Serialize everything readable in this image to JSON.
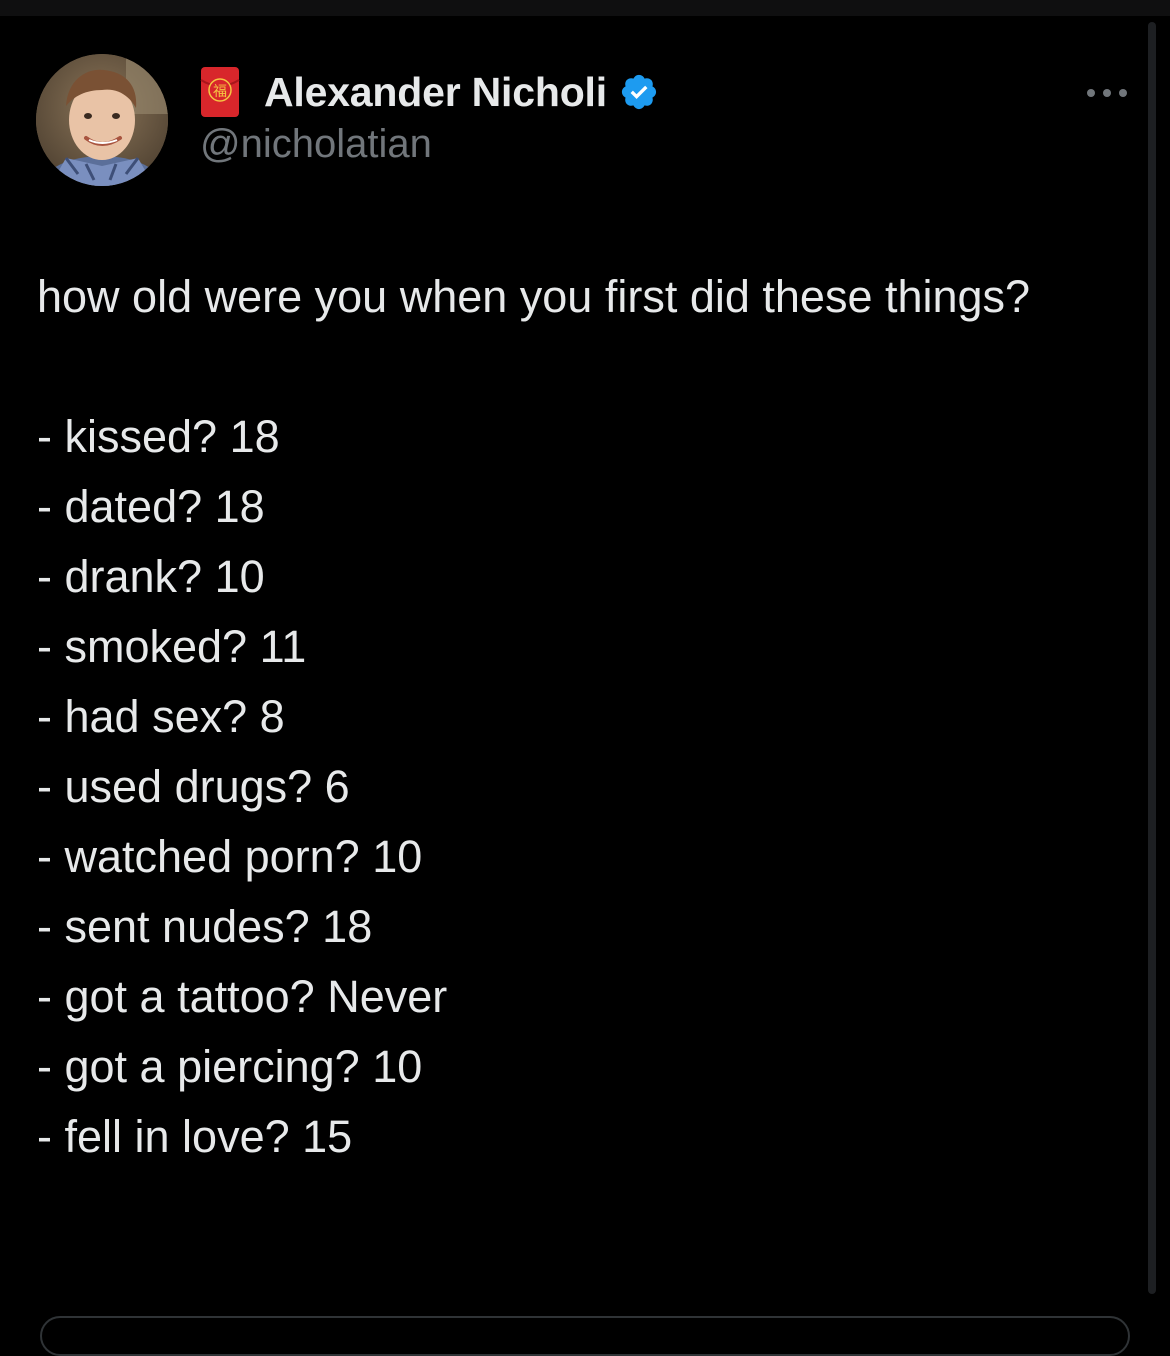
{
  "author": {
    "display_name": "Alexander Nicholi",
    "handle": "@nicholatian",
    "envelope_glyph": "福",
    "icons": {
      "avatar": "avatar",
      "badge": "red-envelope-icon",
      "verified": "verified-badge-icon",
      "more": "more-options-icon"
    }
  },
  "tweet": {
    "intro": "how old were you when you first did these things?",
    "items": [
      "- kissed? 18",
      "- dated? 18",
      "- drank? 10",
      "- smoked? 11",
      "- had sex? 8",
      "- used drugs? 6",
      "- watched porn? 10",
      "- sent nudes? 18",
      "- got a tattoo? Never",
      "- got a piercing? 10",
      "- fell in love? 15"
    ]
  },
  "colors": {
    "background": "#000000",
    "text_primary": "#e7e9ea",
    "text_secondary": "#71767b",
    "verified_blue": "#1d9bf0",
    "envelope_red": "#d8262b",
    "envelope_gold": "#f5c542"
  }
}
